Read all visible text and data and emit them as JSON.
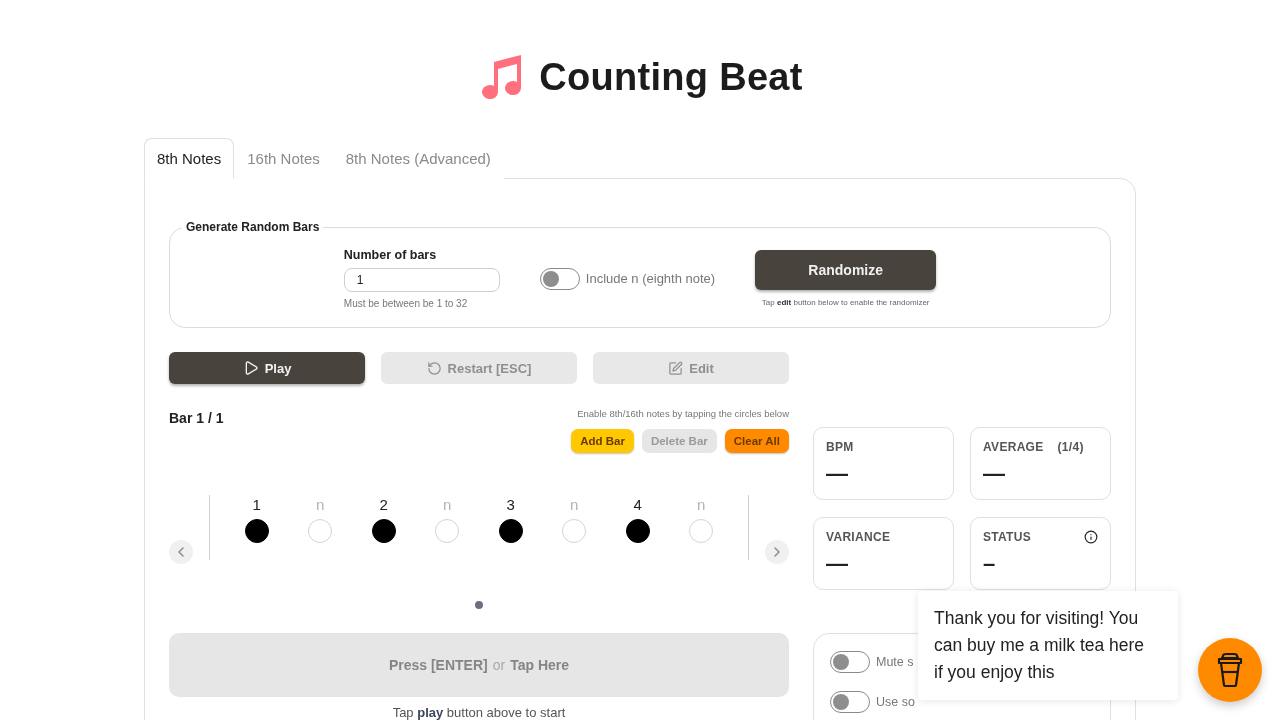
{
  "header": {
    "title": "Counting Beat"
  },
  "tabs": [
    {
      "label": "8th Notes",
      "selected": true
    },
    {
      "label": "16th Notes",
      "selected": false
    },
    {
      "label": "8th Notes (Advanced)",
      "selected": false
    }
  ],
  "generator": {
    "legend": "Generate Random Bars",
    "field": {
      "label": "Number of bars",
      "value": "1",
      "hint": "Must be between be 1 to 32"
    },
    "toggle": {
      "label": "Include n (eighth note)",
      "on": false
    },
    "button": {
      "label": "Randomize"
    },
    "hint": "Tap **edit** button below to enable the randomizer"
  },
  "controls": [
    {
      "kind": "play",
      "label": "Play",
      "disabled": false
    },
    {
      "kind": "restart",
      "label": "Restart [ESC]",
      "disabled": true
    },
    {
      "kind": "edit",
      "label": "Edit",
      "disabled": true
    }
  ],
  "bar": {
    "title": "Bar 1 / 1",
    "hint": "Enable 8th/16th notes by tapping the circles below",
    "actions": [
      {
        "label": "Add Bar",
        "color": "#ffc800",
        "disabled": false
      },
      {
        "label": "Delete Bar",
        "color": "#e6e6e6",
        "disabled": true
      },
      {
        "label": "Clear All",
        "color": "#ff8a00",
        "disabled": false
      }
    ]
  },
  "beats": [
    {
      "kind": "count",
      "label": "1",
      "on": true
    },
    {
      "kind": "offbeat",
      "label": "n",
      "on": false
    },
    {
      "kind": "count",
      "label": "2",
      "on": true
    },
    {
      "kind": "offbeat",
      "label": "n",
      "on": false
    },
    {
      "kind": "count",
      "label": "3",
      "on": true
    },
    {
      "kind": "offbeat",
      "label": "n",
      "on": false
    },
    {
      "kind": "count",
      "label": "4",
      "on": true
    },
    {
      "kind": "offbeat",
      "label": "n",
      "on": false
    }
  ],
  "pages": [
    {
      "selected": true
    }
  ],
  "tap_button": {
    "disabled": true,
    "parts": [
      {
        "kind": "key",
        "text": "Press [ENTER]"
      },
      {
        "kind": "joiner",
        "text": "or"
      },
      {
        "kind": "key",
        "text": "Tap Here"
      }
    ]
  },
  "tap_hint": "Tap **play** button above to start",
  "stats": [
    {
      "label": "BPM",
      "value": "—",
      "info": false
    },
    {
      "label": "AVERAGE",
      "note": "(1/4)",
      "value": "—",
      "info": false
    },
    {
      "label": "VARIANCE",
      "value": "—",
      "info": false
    },
    {
      "label": "STATUS",
      "value": "–",
      "info": true
    }
  ],
  "settings": [
    {
      "label": "Mute s",
      "on": false
    },
    {
      "label": "Use so",
      "on": false
    }
  ],
  "support": {
    "message": "Thank you for visiting! You can buy me a milk tea here if you enjoy this"
  }
}
